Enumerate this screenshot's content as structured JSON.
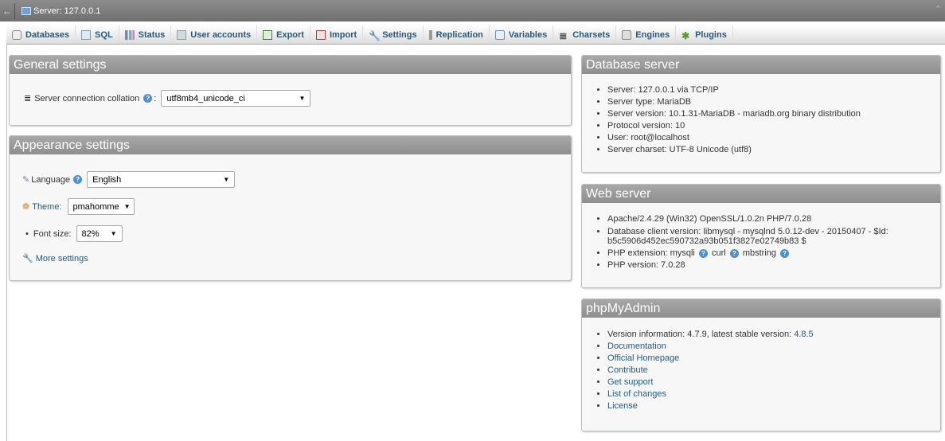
{
  "topbar": {
    "back_symbol": "←",
    "server_label": "Server: 127.0.0.1",
    "collapse_symbol": "⌃"
  },
  "tabs": [
    {
      "label": "Databases",
      "icon": "database-icon"
    },
    {
      "label": "SQL",
      "icon": "sql-icon"
    },
    {
      "label": "Status",
      "icon": "status-icon"
    },
    {
      "label": "User accounts",
      "icon": "users-icon"
    },
    {
      "label": "Export",
      "icon": "export-icon"
    },
    {
      "label": "Import",
      "icon": "import-icon"
    },
    {
      "label": "Settings",
      "icon": "wrench-icon"
    },
    {
      "label": "Replication",
      "icon": "replication-icon"
    },
    {
      "label": "Variables",
      "icon": "variables-icon"
    },
    {
      "label": "Charsets",
      "icon": "charsets-icon"
    },
    {
      "label": "Engines",
      "icon": "engines-icon"
    },
    {
      "label": "Plugins",
      "icon": "plugins-icon"
    }
  ],
  "general": {
    "title": "General settings",
    "collation_label": "Server connection collation",
    "collation_colon": ":",
    "collation_value": "utf8mb4_unicode_ci"
  },
  "appearance": {
    "title": "Appearance settings",
    "language_label": "Language",
    "language_value": "English",
    "theme_label": "Theme:",
    "theme_value": "pmahomme",
    "font_label": "Font size:",
    "font_value": "82%",
    "more_settings": "More settings"
  },
  "db_server": {
    "title": "Database server",
    "items": [
      "Server: 127.0.0.1 via TCP/IP",
      "Server type: MariaDB",
      "Server version: 10.1.31-MariaDB - mariadb.org binary distribution",
      "Protocol version: 10",
      "User: root@localhost",
      "Server charset: UTF-8 Unicode (utf8)"
    ]
  },
  "web_server": {
    "title": "Web server",
    "apache": "Apache/2.4.29 (Win32) OpenSSL/1.0.2n PHP/7.0.28",
    "client_line1": "Database client version: libmysql - mysqlnd 5.0.12-dev - 20150407 - $Id:",
    "client_line2": "b5c5906d452ec590732a93b051f3827e02749b83 $",
    "php_ext_label": "PHP extension: mysqli",
    "php_ext_curl": "curl",
    "php_ext_mbstring": "mbstring",
    "php_version": "PHP version: 7.0.28"
  },
  "pma": {
    "title": "phpMyAdmin",
    "version_text": "Version information: 4.7.9, latest stable version:",
    "latest_version": "4.8.5",
    "links": [
      "Documentation",
      "Official Homepage",
      "Contribute",
      "Get support",
      "List of changes",
      "License"
    ]
  }
}
